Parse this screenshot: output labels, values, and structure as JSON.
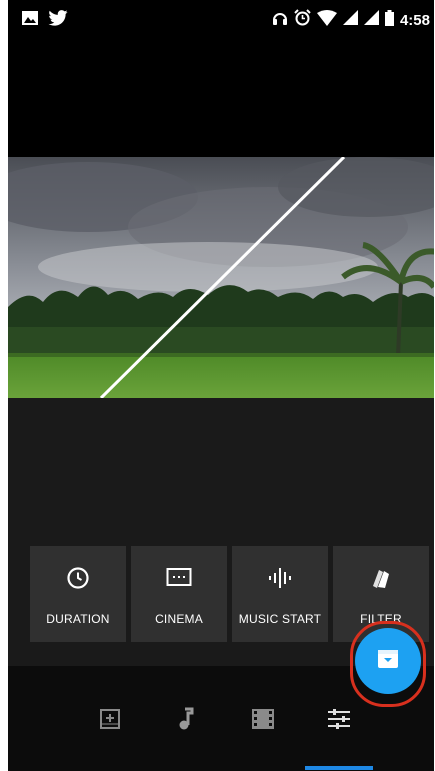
{
  "status_bar": {
    "time": "4:58",
    "left_icons": [
      "image-icon",
      "twitter-icon"
    ],
    "right_icons": [
      "headphones-icon",
      "alarm-icon",
      "wifi-icon",
      "signal-icon",
      "signal-icon",
      "battery-icon"
    ]
  },
  "editor": {
    "options": [
      {
        "label": "DURATION",
        "icon": "clock-icon"
      },
      {
        "label": "CINEMA",
        "icon": "cinema-icon"
      },
      {
        "label": "MUSIC START",
        "icon": "waveform-icon"
      },
      {
        "label": "FILTER",
        "icon": "filter-icon"
      }
    ]
  },
  "bottom_nav": {
    "items": [
      "add-photo-icon",
      "music-note-icon",
      "film-icon",
      "sliders-icon"
    ],
    "selected_index": 3
  },
  "fab": {
    "icon": "save-export-icon"
  },
  "colors": {
    "accent": "#1da1f2",
    "highlight_ring": "#d8301e",
    "nav_indicator": "#1e88e5",
    "panel": "#1a1a1a",
    "tile": "#303030"
  }
}
